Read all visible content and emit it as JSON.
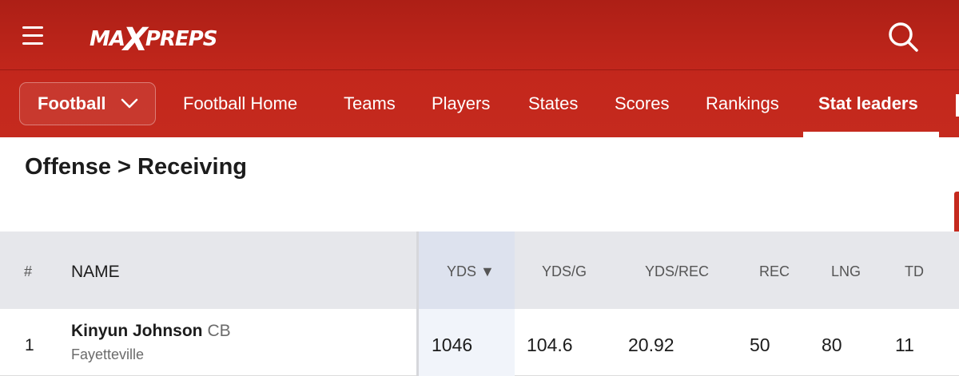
{
  "brand": {
    "logo_text": "MaxPreps",
    "accent": "#c3271c"
  },
  "header": {
    "menu_icon": "hamburger-icon",
    "search_icon": "search-icon"
  },
  "nav": {
    "sport": "Football",
    "links": [
      "Football Home",
      "Teams",
      "Players",
      "States",
      "Scores",
      "Rankings",
      "Stat leaders"
    ],
    "active": "Stat leaders"
  },
  "page": {
    "title": "Offense > Receiving"
  },
  "table": {
    "columns": [
      "#",
      "NAME",
      "YDS ▼",
      "YDS/G",
      "YDS/REC",
      "REC",
      "LNG",
      "TD"
    ],
    "sorted_column": "YDS",
    "rows": [
      {
        "rank": "1",
        "name": "Kinyun Johnson",
        "position": "CB",
        "school": "Fayetteville",
        "yds": "1046",
        "yds_g": "104.6",
        "yds_rec": "20.92",
        "rec": "50",
        "lng": "80",
        "td": "11"
      }
    ]
  }
}
